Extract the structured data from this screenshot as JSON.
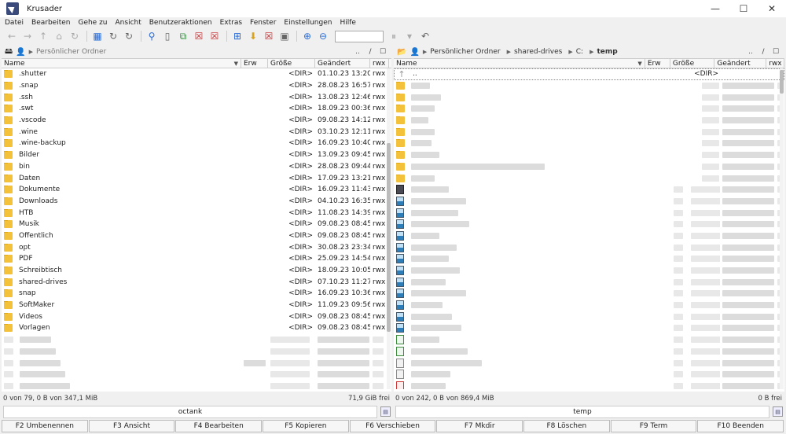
{
  "window": {
    "title": "Krusader",
    "min": "—",
    "max": "☐",
    "close": "✕"
  },
  "menu": [
    "Datei",
    "Bearbeiten",
    "Gehe zu",
    "Ansicht",
    "Benutzeraktionen",
    "Extras",
    "Fenster",
    "Einstellungen",
    "Hilfe"
  ],
  "toolbar": {
    "icons": [
      {
        "name": "back-icon",
        "glyph": "←",
        "tone": "grey"
      },
      {
        "name": "forward-icon",
        "glyph": "→",
        "tone": "grey"
      },
      {
        "name": "up-icon",
        "glyph": "↑",
        "tone": "grey"
      },
      {
        "name": "home-icon",
        "glyph": "⌂",
        "tone": "grey"
      },
      {
        "name": "reload-icon",
        "glyph": "↻",
        "tone": "grey"
      },
      {
        "name": "sep"
      },
      {
        "name": "view-grid-icon",
        "glyph": "▦",
        "tone": "blue"
      },
      {
        "name": "refresh-left-icon",
        "glyph": "↻",
        "tone": ""
      },
      {
        "name": "refresh-right-icon",
        "glyph": "↻",
        "tone": ""
      },
      {
        "name": "sep"
      },
      {
        "name": "search-icon",
        "glyph": "⚲",
        "tone": "blue"
      },
      {
        "name": "new-file-icon",
        "glyph": "▯",
        "tone": ""
      },
      {
        "name": "compare-icon",
        "glyph": "⧉",
        "tone": "green"
      },
      {
        "name": "delete-left-icon",
        "glyph": "☒",
        "tone": "red"
      },
      {
        "name": "delete-right-icon",
        "glyph": "☒",
        "tone": "red"
      },
      {
        "name": "sep"
      },
      {
        "name": "network-icon",
        "glyph": "⊞",
        "tone": "blue"
      },
      {
        "name": "mount-icon",
        "glyph": "⬇",
        "tone": "gold"
      },
      {
        "name": "unmount-icon",
        "glyph": "☒",
        "tone": "red"
      },
      {
        "name": "terminal-icon",
        "glyph": "▣",
        "tone": ""
      },
      {
        "name": "sep"
      },
      {
        "name": "zoom-in-icon",
        "glyph": "⊕",
        "tone": "blue"
      },
      {
        "name": "zoom-out-icon",
        "glyph": "⊖",
        "tone": "blue"
      },
      {
        "name": "search-box"
      },
      {
        "name": "pause-icon",
        "glyph": "⏸",
        "tone": "grey"
      },
      {
        "name": "dropdown-icon",
        "glyph": "▾",
        "tone": "grey"
      },
      {
        "name": "undo-icon",
        "glyph": "↶",
        "tone": ""
      }
    ]
  },
  "left_panel": {
    "crumbs": [
      "Persönlicher Ordner"
    ],
    "path_tools": [
      "..",
      "/",
      "☐"
    ],
    "columns": [
      "Name",
      "Erw",
      "Größe",
      "Geändert",
      "rwx"
    ],
    "rows": [
      {
        "name": ".shutter",
        "size": "<DIR>",
        "date": "01.10.23 13:20",
        "perm": "rwx"
      },
      {
        "name": ".snap",
        "size": "<DIR>",
        "date": "28.08.23 16:57",
        "perm": "rwx"
      },
      {
        "name": ".ssh",
        "size": "<DIR>",
        "date": "13.08.23 12:46",
        "perm": "rwx"
      },
      {
        "name": ".swt",
        "size": "<DIR>",
        "date": "18.09.23 00:36",
        "perm": "rwx"
      },
      {
        "name": ".vscode",
        "size": "<DIR>",
        "date": "09.08.23 14:12",
        "perm": "rwx"
      },
      {
        "name": ".wine",
        "size": "<DIR>",
        "date": "03.10.23 12:11",
        "perm": "rwx"
      },
      {
        "name": ".wine-backup",
        "size": "<DIR>",
        "date": "16.09.23 10:40",
        "perm": "rwx"
      },
      {
        "name": "Bilder",
        "size": "<DIR>",
        "date": "13.09.23 09:45",
        "perm": "rwx"
      },
      {
        "name": "bin",
        "size": "<DIR>",
        "date": "28.08.23 09:44",
        "perm": "rwx"
      },
      {
        "name": "Daten",
        "size": "<DIR>",
        "date": "17.09.23 13:21",
        "perm": "rwx"
      },
      {
        "name": "Dokumente",
        "size": "<DIR>",
        "date": "16.09.23 11:43",
        "perm": "rwx"
      },
      {
        "name": "Downloads",
        "size": "<DIR>",
        "date": "04.10.23 16:35",
        "perm": "rwx"
      },
      {
        "name": "HTB",
        "size": "<DIR>",
        "date": "11.08.23 14:39",
        "perm": "rwx"
      },
      {
        "name": "Musik",
        "size": "<DIR>",
        "date": "09.08.23 08:45",
        "perm": "rwx"
      },
      {
        "name": "Öffentlich",
        "size": "<DIR>",
        "date": "09.08.23 08:45",
        "perm": "rwx"
      },
      {
        "name": "opt",
        "size": "<DIR>",
        "date": "30.08.23 23:34",
        "perm": "rwx"
      },
      {
        "name": "PDF",
        "size": "<DIR>",
        "date": "25.09.23 14:54",
        "perm": "rwx"
      },
      {
        "name": "Schreibtisch",
        "size": "<DIR>",
        "date": "18.09.23 10:05",
        "perm": "rwx"
      },
      {
        "name": "shared-drives",
        "size": "<DIR>",
        "date": "07.10.23 11:27",
        "perm": "rwx"
      },
      {
        "name": "snap",
        "size": "<DIR>",
        "date": "16.09.23 10:36",
        "perm": "rwx"
      },
      {
        "name": "SoftMaker",
        "size": "<DIR>",
        "date": "11.09.23 09:56",
        "perm": "rwx"
      },
      {
        "name": "Videos",
        "size": "<DIR>",
        "date": "09.08.23 08:45",
        "perm": "rwx"
      },
      {
        "name": "Vorlagen",
        "size": "<DIR>",
        "date": "09.08.23 08:45",
        "perm": "rwx"
      }
    ],
    "status": "0 von 79, 0 B von 347,1 MiB",
    "free": "71,9 GiB frei",
    "cmdline": "octank"
  },
  "right_panel": {
    "crumbs": [
      "Persönlicher Ordner",
      "shared-drives",
      "C:",
      "temp"
    ],
    "path_tools": [
      "..",
      "/",
      "☐"
    ],
    "columns": [
      "Name",
      "Erw",
      "Größe",
      "Geändert",
      "rwx"
    ],
    "up_row": {
      "name": "..",
      "size": "<DIR>"
    },
    "icon_rows": [
      "folder",
      "folder",
      "folder",
      "folder",
      "folder",
      "folder",
      "folder",
      "folder",
      "folder",
      "dark",
      "img",
      "img",
      "img",
      "img",
      "img",
      "img",
      "img",
      "img",
      "img",
      "img",
      "img",
      "img",
      "xls",
      "xls",
      "doc",
      "doc",
      "pdf"
    ],
    "status": "0 von 242, 0 B von 869,4 MiB",
    "free": "0 B frei",
    "cmdline": "temp"
  },
  "fkeys": [
    "F2 Umbenennen",
    "F3 Ansicht",
    "F4 Bearbeiten",
    "F5 Kopieren",
    "F6 Verschieben",
    "F7 Mkdir",
    "F8 Löschen",
    "F9 Term",
    "F10 Beenden"
  ]
}
